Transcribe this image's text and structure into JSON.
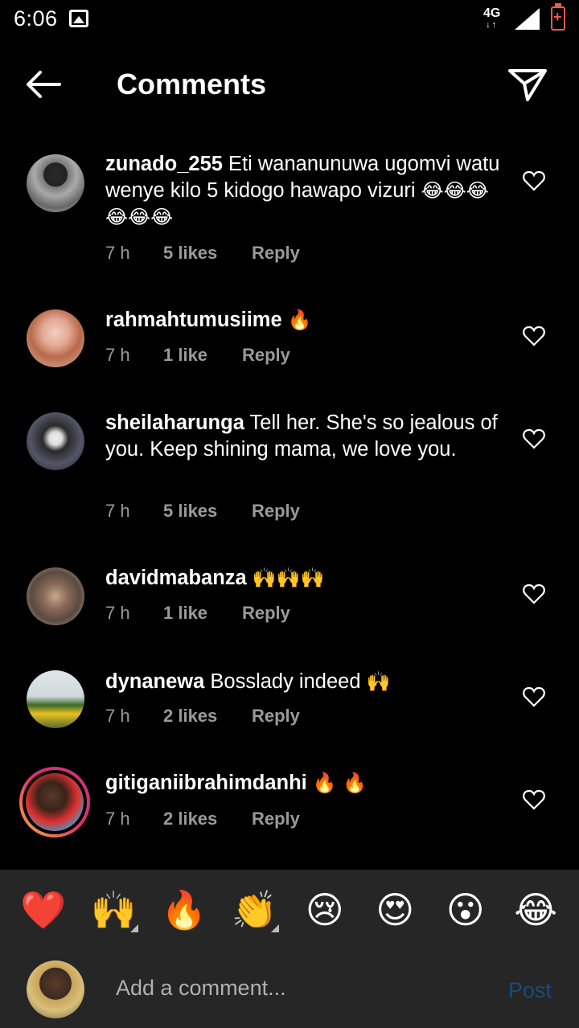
{
  "status_bar": {
    "time": "6:06",
    "network_top": "4G",
    "network_bottom": "↓↑"
  },
  "header": {
    "title": "Comments"
  },
  "comments": [
    {
      "username": "zunado_255",
      "text": " Eti wananunuwa  ugomvi watu wenye kilo 5 kidogo hawapo vizuri ",
      "emoji": "😂😂😂😂😂😂",
      "time": "7 h",
      "likes": "5 likes",
      "reply": "Reply"
    },
    {
      "username": "rahmahtumusiime",
      "text": " ",
      "emoji": "🔥",
      "time": "7 h",
      "likes": "1 like",
      "reply": "Reply"
    },
    {
      "username": "sheilaharunga",
      "text": " Tell her. She's so jealous of you. Keep shining mama, we love you.",
      "emoji": "",
      "time": "7 h",
      "likes": "5 likes",
      "reply": "Reply"
    },
    {
      "username": "davidmabanza",
      "text": " ",
      "emoji": "🙌🙌🙌",
      "time": "7 h",
      "likes": "1 like",
      "reply": "Reply"
    },
    {
      "username": "dynanewa",
      "text": " Bosslady indeed ",
      "emoji": "🙌",
      "time": "7 h",
      "likes": "2 likes",
      "reply": "Reply"
    },
    {
      "username": "gitiganiibrahimdanhi",
      "text": " ",
      "emoji": "🔥 🔥",
      "time": "7 h",
      "likes": "2 likes",
      "reply": "Reply"
    }
  ],
  "emoji_bar": [
    "❤️",
    "🙌",
    "🔥",
    "👏",
    "😢",
    "😍",
    "😮",
    "😂"
  ],
  "compose": {
    "placeholder": "Add a comment...",
    "post_label": "Post"
  },
  "colors": {
    "background": "#000000",
    "muted": "#9a9a9a",
    "bar": "#262626",
    "post": "#1b4a78"
  }
}
